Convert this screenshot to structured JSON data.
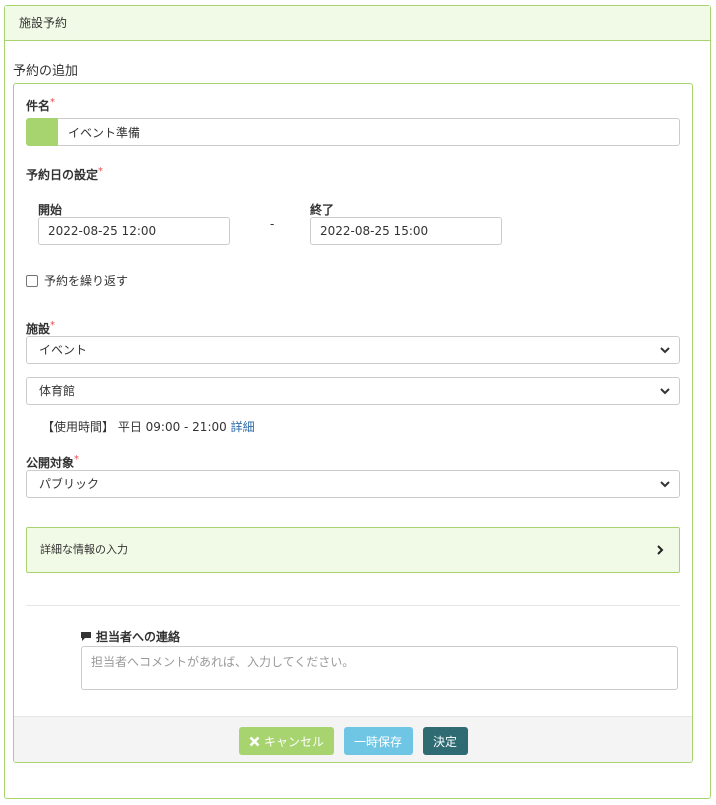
{
  "panel": {
    "title": "施設予約"
  },
  "section": {
    "title": "予約の追加"
  },
  "form": {
    "subject": {
      "label": "件名",
      "required_mark": "*",
      "value": "イベント準備",
      "color": "#a7d46f"
    },
    "date": {
      "label": "予約日の設定",
      "required_mark": "*",
      "start_label": "開始",
      "start_value": "2022-08-25 12:00",
      "separator": "-",
      "end_label": "終了",
      "end_value": "2022-08-25 15:00"
    },
    "repeat": {
      "label": "予約を繰り返す",
      "checked": false
    },
    "facility": {
      "label": "施設",
      "required_mark": "*",
      "category_value": "イベント",
      "facility_value": "体育館",
      "usage_text": "【使用時間】 平日 09:00 - 21:00",
      "usage_link": "詳細"
    },
    "visibility": {
      "label": "公開対象",
      "required_mark": "*",
      "value": "パブリック"
    },
    "details": {
      "label": "詳細な情報の入力"
    },
    "comment": {
      "label": "担当者への連絡",
      "placeholder": "担当者へコメントがあれば、入力してください。"
    }
  },
  "buttons": {
    "cancel": "キャンセル",
    "draft": "一時保存",
    "submit": "決定"
  },
  "colors": {
    "accent": "#a7d46f",
    "accent_bg": "#f1fae6",
    "info": "#6fc6e4",
    "primary": "#2e6b73"
  },
  "icons": {
    "cancel": "close-icon",
    "comment": "comment-icon",
    "select": "chevron-down-icon",
    "accordion": "chevron-right-icon"
  }
}
